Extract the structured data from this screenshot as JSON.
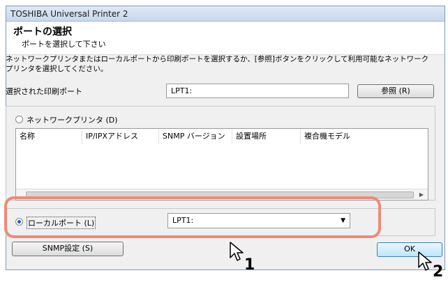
{
  "window": {
    "title": "TOSHIBA Universal Printer 2"
  },
  "header": {
    "title": "ポートの選択",
    "subtitle": "ポートを選択して下さい"
  },
  "description": "ネットワークプリンタまたはローカルポートから印刷ポートを選択するか、[参照]ボタンをクリックして利用可能なネットワークプリンタを選択してください。",
  "selected_port": {
    "label": "選択された印刷ポート",
    "value": "LPT1:",
    "browse_button": "参照 (R)"
  },
  "network_printer": {
    "radio_label": "ネットワークプリンタ (D)",
    "selected": false,
    "columns": [
      "名称",
      "IP/IPXアドレス",
      "SNMP バージョン",
      "設置場所",
      "複合機モデル"
    ]
  },
  "local_port": {
    "radio_label": "ローカルポート (L)",
    "selected": true,
    "combo_value": "LPT1:"
  },
  "buttons": {
    "snmp": "SNMP設定 (S)",
    "ok": "OK"
  },
  "callouts": [
    "1",
    "2"
  ],
  "colors": {
    "highlight": "#ee8a78",
    "title_bar": "#c7d8ee"
  }
}
